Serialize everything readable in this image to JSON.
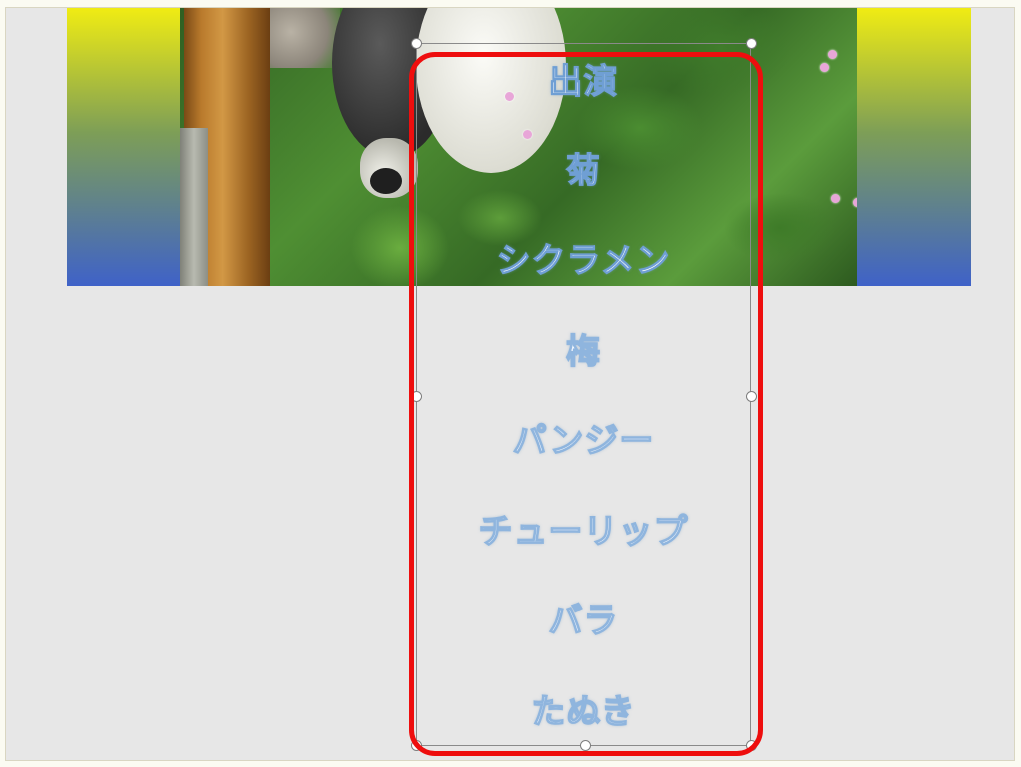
{
  "slide": {
    "band": {
      "gradient_colors": [
        "#f0ec13",
        "#7d9e57",
        "#3f62c8"
      ]
    },
    "photo": {
      "icon": "tanuki-statue-among-ivy-photo"
    },
    "credits_textbox": {
      "lines": [
        "出演",
        "菊",
        "シクラメン",
        "梅",
        "パンジー",
        "チューリップ",
        "バラ",
        "たぬき"
      ],
      "text_color": "#ffffff",
      "outline_color": "#9ec4ea"
    },
    "highlight": {
      "color": "#ee0e0e"
    }
  }
}
